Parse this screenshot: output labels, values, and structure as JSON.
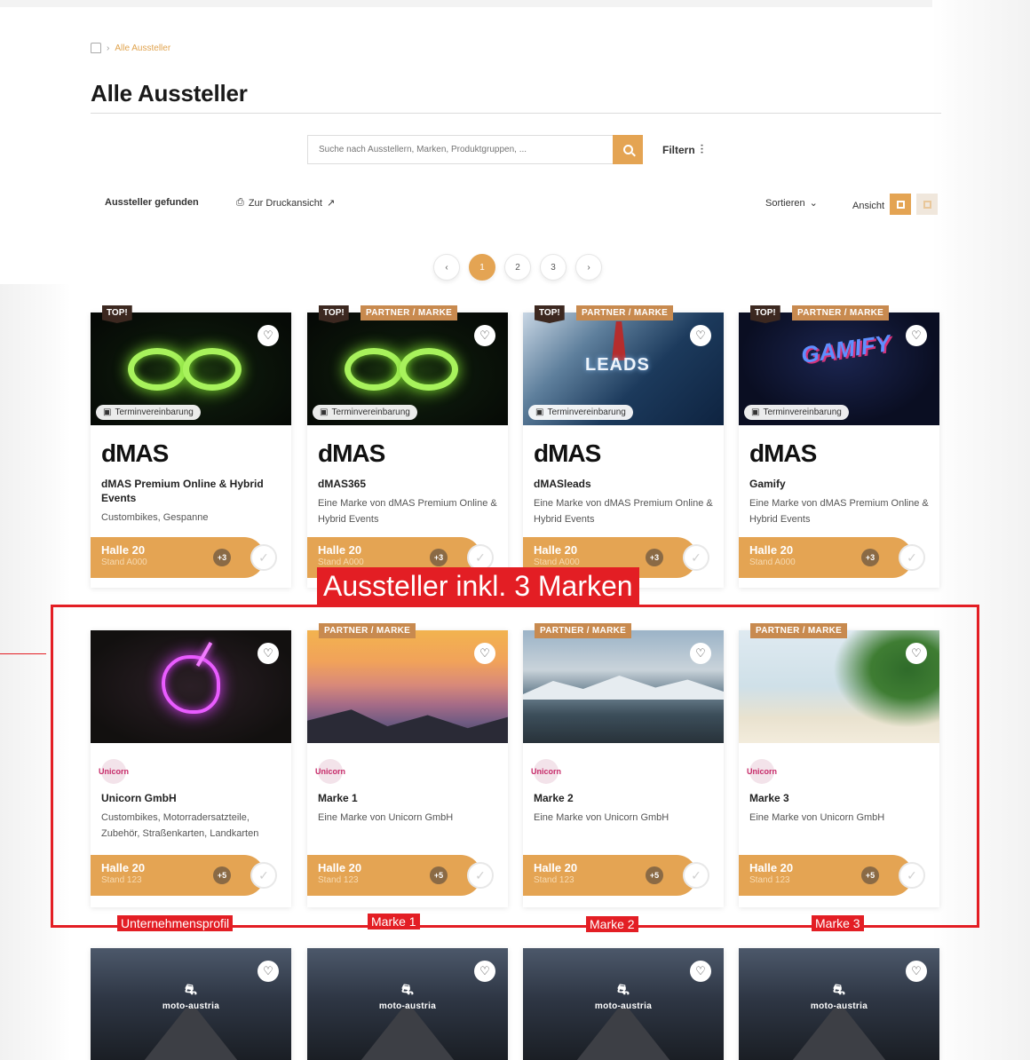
{
  "breadcrumb": {
    "current": "Alle Aussteller"
  },
  "title": "Alle Aussteller",
  "search": {
    "placeholder": "Suche nach Ausstellern, Marken, Produktgruppen, ...",
    "filter_label": "Filtern"
  },
  "toolbar": {
    "found_label": "Aussteller gefunden",
    "print_label": "Zur Druckansicht",
    "sort_label": "Sortieren",
    "view_label": "Ansicht"
  },
  "pagination": {
    "pages": [
      "1",
      "2",
      "3"
    ],
    "prev": "‹",
    "next": "›",
    "active": 1
  },
  "tags": {
    "top": "TOP!",
    "partner": "PARTNER / MARKE",
    "appointment": "Terminvereinbarung"
  },
  "row1": [
    {
      "logo": "dMAS",
      "name": "dMAS Premium Online & Hybrid Events",
      "desc": "Custombikes, Gespanne",
      "hall": "Halle 20",
      "stand": "Stand A000",
      "count": "+3"
    },
    {
      "logo": "dMAS",
      "name": "dMAS365",
      "desc": "Eine Marke von dMAS Premium Online & Hybrid Events",
      "hall": "Halle 20",
      "stand": "Stand A000",
      "count": "+3"
    },
    {
      "logo": "dMAS",
      "name": "dMASleads",
      "desc": "Eine Marke von dMAS Premium Online & Hybrid Events",
      "hall": "Halle 20",
      "stand": "Stand A000",
      "count": "+3"
    },
    {
      "logo": "dMAS",
      "name": "Gamify",
      "desc": "Eine Marke von dMAS Premium Online & Hybrid Events",
      "hall": "Halle 20",
      "stand": "Stand A000",
      "count": "+3"
    }
  ],
  "row2": [
    {
      "name": "Unicorn GmbH",
      "desc": "Custombikes, Motorradersatzteile, Zubehör, Straßenkarten, Landkarten",
      "hall": "Halle 20",
      "stand": "Stand 123",
      "count": "+5"
    },
    {
      "name": "Marke 1",
      "desc": "Eine Marke von Unicorn GmbH",
      "hall": "Halle 20",
      "stand": "Stand 123",
      "count": "+5"
    },
    {
      "name": "Marke 2",
      "desc": "Eine Marke von Unicorn GmbH",
      "hall": "Halle 20",
      "stand": "Stand 123",
      "count": "+5"
    },
    {
      "name": "Marke 3",
      "desc": "Eine Marke von Unicorn GmbH",
      "hall": "Halle 20",
      "stand": "Stand 123",
      "count": "+5"
    }
  ],
  "row3_logo": "moto-austria",
  "annotation": {
    "title": "Aussteller inkl. 3 Marken",
    "labels": [
      "Unternehmensprofil",
      "Marke 1",
      "Marke 2",
      "Marke 3"
    ],
    "color": "#e31e24"
  },
  "colors": {
    "accent": "#e4a453",
    "top_tag": "#3c2820",
    "partner_tag": "#c88a4f"
  }
}
